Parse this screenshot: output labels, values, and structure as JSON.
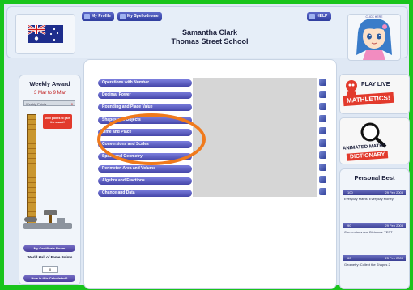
{
  "header": {
    "my_profile": "My Profile",
    "my_spellodrome": "My Spellodrome",
    "help": "HELP",
    "user_menu": "CLICK HERE",
    "student_name": "Samantha  Clark",
    "school_name": "Thomas Street School"
  },
  "weekly_award": {
    "title": "Weekly Award",
    "date_range": "3 Mar to 9 Mar",
    "points_label": "Weekly Points",
    "points_value": "0",
    "goal_text": "1000 points to gain the award!",
    "certificate_button": "My Certificate Room",
    "hall_of_fame_label": "World Hall of Fame Points",
    "hall_of_fame_value": "0",
    "calculated_button": "How is this Calculated?"
  },
  "topics": [
    {
      "label": "Operations with Number"
    },
    {
      "label": "Decimal Power"
    },
    {
      "label": "Rounding and Place Value"
    },
    {
      "label": "Shapes and Objects"
    },
    {
      "label": "Time and Place"
    },
    {
      "label": "Conversions and Scales"
    },
    {
      "label": "Space and Geometry"
    },
    {
      "label": "Perimeter, Area and Volume"
    },
    {
      "label": "Algebra and Fractions"
    },
    {
      "label": "Chance and Data"
    }
  ],
  "ads": {
    "play_live_line1": "PLAY LIVE",
    "play_live_line2": "MATHLETICS!",
    "dictionary_line1": "ANIMATED MATHS",
    "dictionary_line2": "DICTIONARY"
  },
  "personal_best": {
    "title": "Personal Best",
    "entries": [
      {
        "score": "100",
        "date": "29 Feb 2008",
        "description": "Everyday Maths: Everyday Money"
      },
      {
        "score": "90",
        "date": "29 Feb 2008",
        "description": "Conversions and Divisions: TEST"
      },
      {
        "score": "60",
        "date": "25 Feb 2008",
        "description": "Geometry: Collect the Shapes 2"
      }
    ]
  },
  "colors": {
    "frame_green": "#19c41c",
    "button_purple": "#4647a9",
    "highlight_orange": "#f07a1c",
    "award_red": "#c01818"
  }
}
